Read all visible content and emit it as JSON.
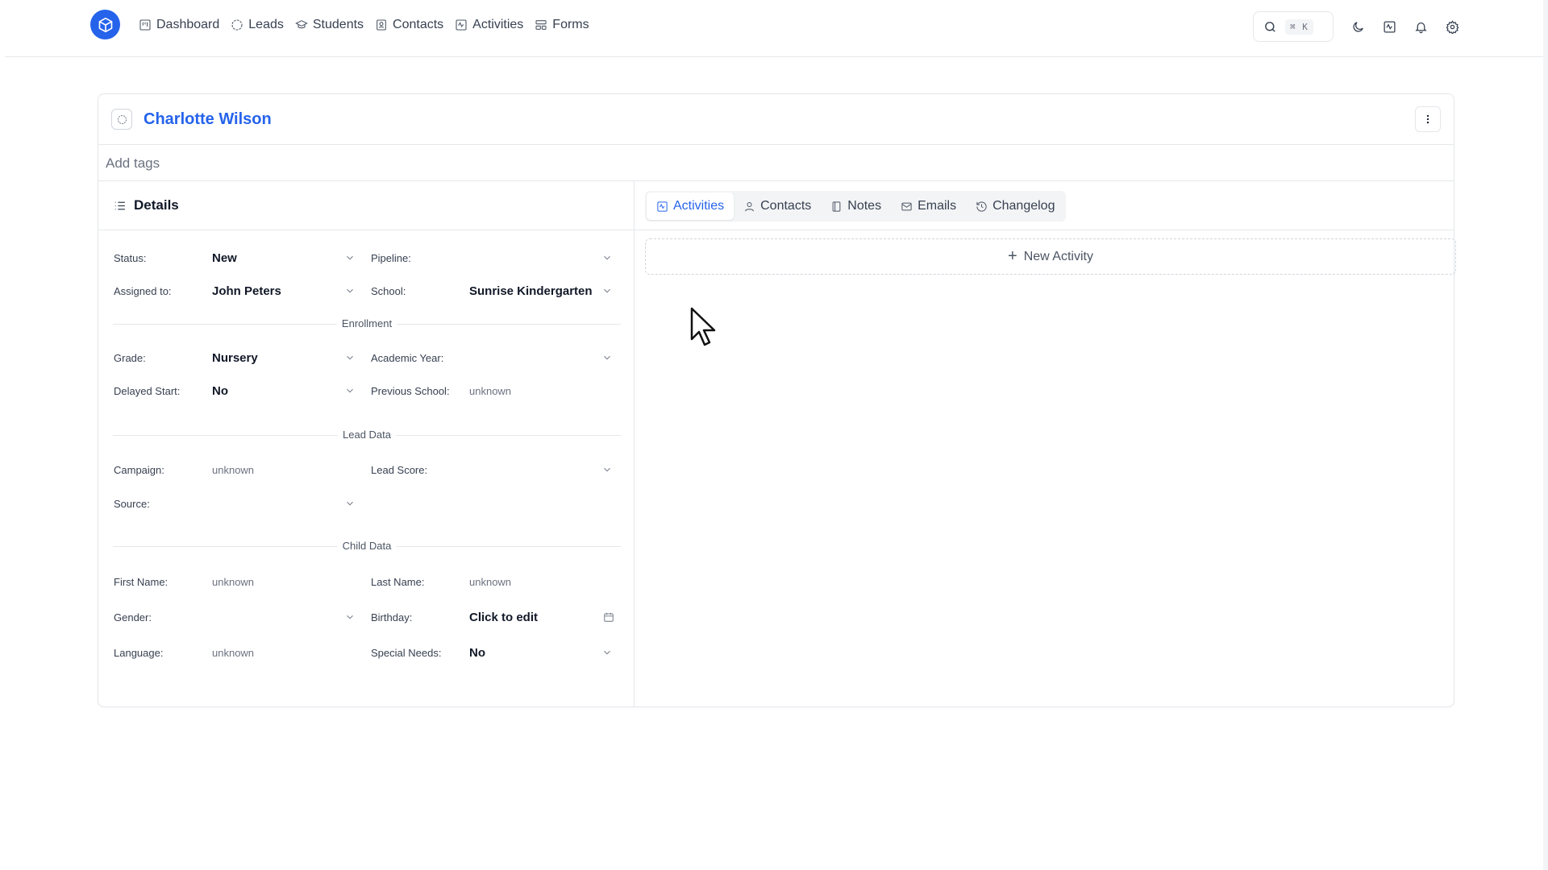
{
  "nav": {
    "items": [
      {
        "label": "Dashboard",
        "icon": "dashboard-icon"
      },
      {
        "label": "Leads",
        "icon": "leads-icon"
      },
      {
        "label": "Students",
        "icon": "graduation-cap-icon"
      },
      {
        "label": "Contacts",
        "icon": "contact-card-icon"
      },
      {
        "label": "Activities",
        "icon": "activity-icon"
      },
      {
        "label": "Forms",
        "icon": "forms-icon"
      }
    ],
    "search_shortcut": "⌘ K"
  },
  "lead": {
    "name": "Charlotte Wilson",
    "tags_placeholder": "Add tags"
  },
  "details": {
    "title": "Details",
    "status": {
      "label": "Status:",
      "value": "New"
    },
    "pipeline": {
      "label": "Pipeline:",
      "value": ""
    },
    "assigned": {
      "label": "Assigned to:",
      "value": "John Peters"
    },
    "school": {
      "label": "School:",
      "value": "Sunrise Kindergarten"
    },
    "section_enrollment": "Enrollment",
    "grade": {
      "label": "Grade:",
      "value": "Nursery"
    },
    "academic_year": {
      "label": "Academic Year:",
      "value": ""
    },
    "delayed_start": {
      "label": "Delayed Start:",
      "value": "No"
    },
    "previous_school": {
      "label": "Previous School:",
      "value": "unknown"
    },
    "section_lead": "Lead Data",
    "campaign": {
      "label": "Campaign:",
      "value": "unknown"
    },
    "lead_score": {
      "label": "Lead Score:",
      "value": ""
    },
    "source": {
      "label": "Source:",
      "value": ""
    },
    "section_child": "Child Data",
    "first_name": {
      "label": "First Name:",
      "value": "unknown"
    },
    "last_name": {
      "label": "Last Name:",
      "value": "unknown"
    },
    "gender": {
      "label": "Gender:",
      "value": ""
    },
    "birthday": {
      "label": "Birthday:",
      "value": "Click to edit"
    },
    "language": {
      "label": "Language:",
      "value": "unknown"
    },
    "special_needs": {
      "label": "Special Needs:",
      "value": "No"
    }
  },
  "tabs": [
    {
      "label": "Activities",
      "icon": "activity-icon",
      "active": true
    },
    {
      "label": "Contacts",
      "icon": "person-icon",
      "active": false
    },
    {
      "label": "Notes",
      "icon": "notebook-icon",
      "active": false
    },
    {
      "label": "Emails",
      "icon": "mail-icon",
      "active": false
    },
    {
      "label": "Changelog",
      "icon": "history-icon",
      "active": false
    }
  ],
  "new_activity_label": "New Activity",
  "colors": {
    "accent": "#2563eb"
  }
}
